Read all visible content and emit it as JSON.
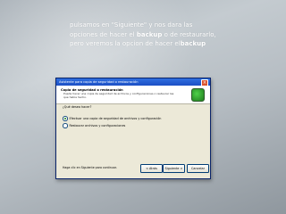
{
  "slide": {
    "caption_line1": "pulsamos en \"Siguiente\" y nos dara las",
    "caption_line2_pre": "opciones de hacer el ",
    "caption_line2_bold": "backup",
    "caption_line2_post": " o de restaurarlo,",
    "caption_line3_pre": "pero veremos la opcion de hacer el",
    "caption_line3_bold": "backup"
  },
  "dialog": {
    "title": "Asistente para copia de seguridad o restauración",
    "close_glyph": "×",
    "header_title": "Copia de seguridad o restauración",
    "header_description": "Puede hacer una copia de seguridad de archivos y configuraciones o restaurar las que había hecho.",
    "question": "¿Qué desea hacer?",
    "options": [
      {
        "label": "Efectuar una copia de seguridad de archivos y configuración",
        "selected": true
      },
      {
        "label": "Restaurar archivos y configuraciones",
        "selected": false
      }
    ],
    "hint": "Haga clic en Siguiente para continuar.",
    "buttons": {
      "back": "< Atrás",
      "next": "Siguiente >",
      "cancel": "Cancelar"
    }
  },
  "colors": {
    "titlebar": "#1c4fc4",
    "slide_bg": "#b7bec4"
  }
}
